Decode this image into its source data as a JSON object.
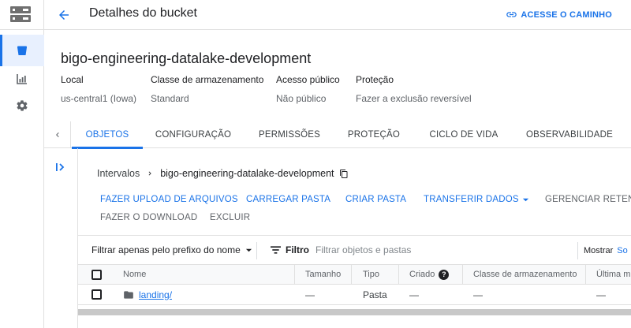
{
  "header": {
    "title": "Detalhes do bucket",
    "access_path": "ACESSE O CAMINHO"
  },
  "bucket": {
    "name": "bigo-engineering-datalake-development",
    "meta": [
      {
        "key": "Local",
        "value": "us-central1 (Iowa)"
      },
      {
        "key": "Classe de armazenamento",
        "value": "Standard"
      },
      {
        "key": "Acesso público",
        "value": "Não público"
      },
      {
        "key": "Proteção",
        "value": "Fazer a exclusão reversível"
      }
    ]
  },
  "tabs": [
    {
      "label": "OBJETOS",
      "active": true
    },
    {
      "label": "CONFIGURAÇÃO"
    },
    {
      "label": "PERMISSÕES"
    },
    {
      "label": "PROTEÇÃO"
    },
    {
      "label": "CICLO DE VIDA"
    },
    {
      "label": "OBSERVABILIDADE"
    }
  ],
  "breadcrumb": {
    "root": "Intervalos",
    "current": "bigo-engineering-datalake-development"
  },
  "actions": {
    "upload_files": "FAZER UPLOAD DE ARQUIVOS",
    "upload_folder": "CARREGAR PASTA",
    "create_folder": "CRIAR PASTA",
    "transfer_data": "TRANSFERIR DADOS",
    "manage_retention": "GERENCIAR RETENÇ",
    "download": "FAZER O DOWNLOAD",
    "delete": "EXCLUIR"
  },
  "filter": {
    "prefix_select": "Filtrar apenas pelo prefixo do nome",
    "label": "Filtro",
    "placeholder": "Filtrar objetos e pastas",
    "show_label": "Mostrar",
    "show_link": "So"
  },
  "table": {
    "columns": [
      "Nome",
      "Tamanho",
      "Tipo",
      "Criado",
      "Classe de armazenamento",
      "Última m"
    ],
    "help_icon": "?",
    "rows": [
      {
        "name": "landing/",
        "size": "—",
        "type": "Pasta",
        "created": "—",
        "storage_class": "—",
        "last_modified": "—"
      }
    ]
  },
  "colors": {
    "accent": "#1a73e8",
    "text": "#202124",
    "muted": "#5f6368",
    "active_bg": "#e8f0fe"
  }
}
